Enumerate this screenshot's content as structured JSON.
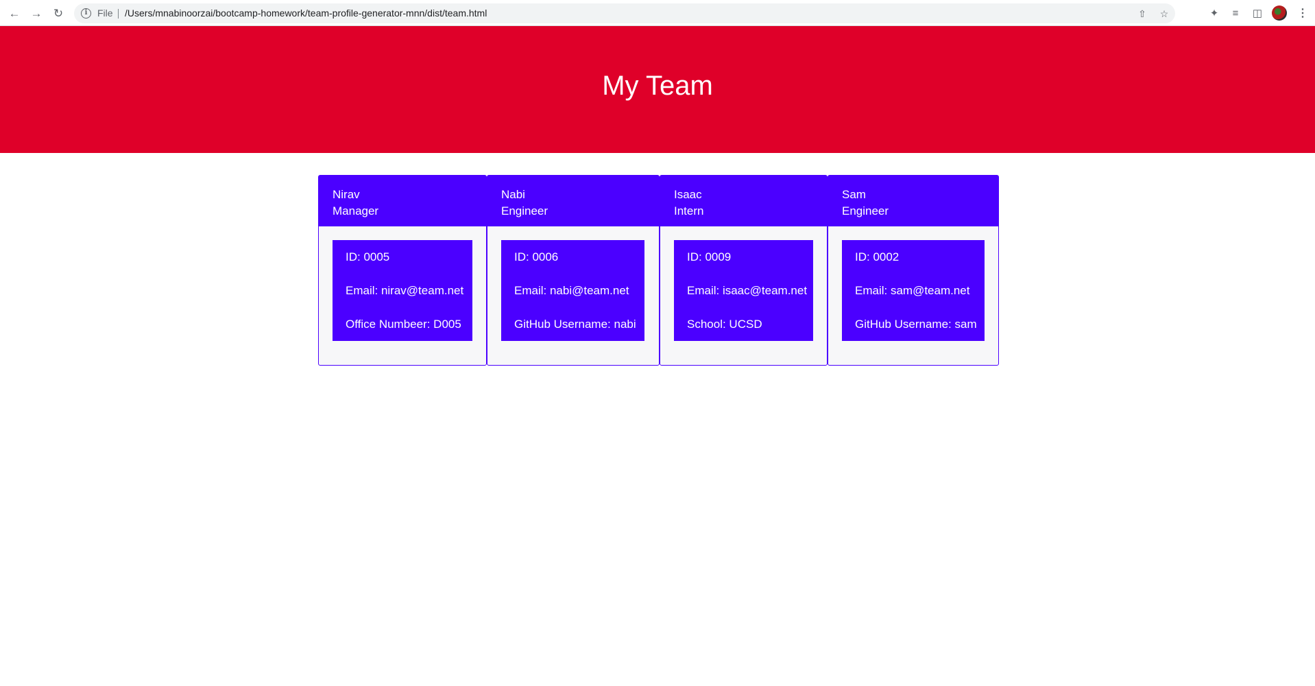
{
  "browser": {
    "scheme_label": "File",
    "url": "/Users/mnabinoorzai/bootcamp-homework/team-profile-generator-mnn/dist/team.html",
    "icons": {
      "back": "arrow-left",
      "forward": "arrow-right",
      "reload": "reload",
      "site_info": "info",
      "share": "share",
      "bookmark": "star",
      "extensions": "puzzle",
      "reading_list": "reading-list",
      "side_panel": "side-panel",
      "profile": "avatar",
      "menu": "three-dots"
    }
  },
  "header": {
    "title": "My Team",
    "background": "#df0029"
  },
  "team": [
    {
      "name": "Nirav",
      "role": "Manager",
      "id": "ID: 0005",
      "email": "Email: nirav@team.net",
      "extra": "Office Numbeer: D005"
    },
    {
      "name": "Nabi",
      "role": "Engineer",
      "id": "ID: 0006",
      "email": "Email: nabi@team.net",
      "extra": "GitHub Username: nabi"
    },
    {
      "name": "Isaac",
      "role": "Intern",
      "id": "ID: 0009",
      "email": "Email: isaac@team.net",
      "extra": "School: UCSD"
    },
    {
      "name": "Sam",
      "role": "Engineer",
      "id": "ID: 0002",
      "email": "Email: sam@team.net",
      "extra": "GitHub Username: sam"
    }
  ],
  "colors": {
    "card_accent": "#4b00ff",
    "card_background": "#f7f7f9"
  }
}
